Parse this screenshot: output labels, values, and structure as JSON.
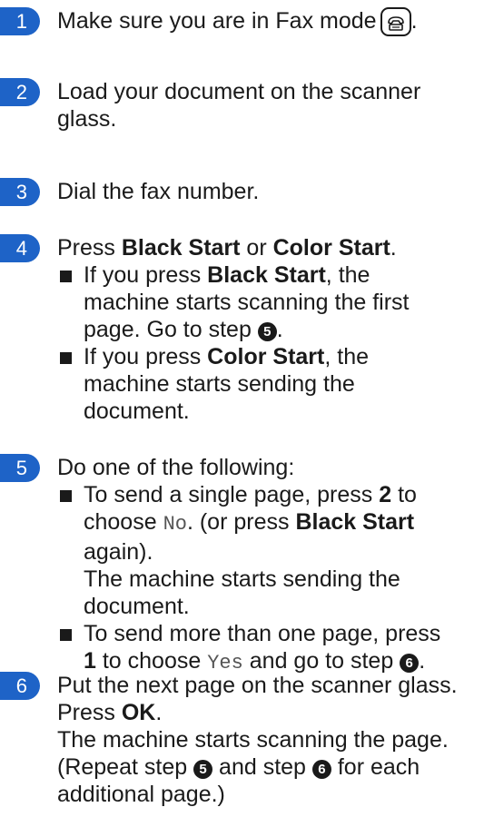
{
  "steps": [
    {
      "num": "1",
      "line1": "Make sure you are in Fax mode",
      "end": "."
    },
    {
      "num": "2",
      "line1": "Load your document on the scanner",
      "line2": "glass."
    },
    {
      "num": "3",
      "line1": "Dial the fax number."
    },
    {
      "num": "4",
      "press": "Press ",
      "bs": "Black Start",
      "or": " or ",
      "cs": "Color Start",
      "dot": ".",
      "b1": {
        "pre": "If you press ",
        "bold": "Black Start",
        "post": ", the",
        "l2": "machine starts scanning the first",
        "l3a": "page. Go to step ",
        "ref": "5",
        "l3b": "."
      },
      "b2": {
        "pre": "If you press ",
        "bold": "Color Start",
        "post": ", the",
        "l2": "machine starts sending the",
        "l3": "document."
      }
    },
    {
      "num": "5",
      "line1": "Do one of the following:",
      "b1": {
        "pre": "To send a single page, press ",
        "key": "2",
        "post": " to",
        "choose": "choose ",
        "val": "No",
        "after": ". (or press ",
        "bs": "Black Start",
        "again": "again).",
        "m1": "The machine starts sending the",
        "m2": "document."
      },
      "b2": {
        "pre": "To send more than one page, press",
        "key": "1",
        "mid": " to choose ",
        "val": "Yes",
        "post": " and go to step ",
        "ref": "6",
        "end": "."
      }
    },
    {
      "num": "6",
      "line1": "Put the next page on the scanner glass.",
      "press": "Press ",
      "ok": "OK",
      "dot": ".",
      "l3": "The machine starts scanning the page.",
      "l4a": "(Repeat step ",
      "r1": "5",
      "l4b": " and step ",
      "r2": "6",
      "l4c": " for each",
      "l5": "additional page.)"
    }
  ]
}
